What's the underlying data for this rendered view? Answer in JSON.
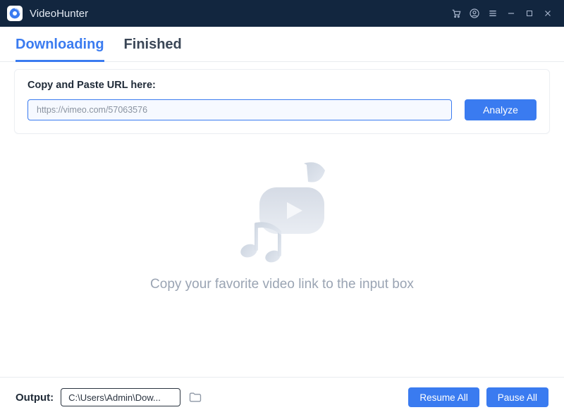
{
  "app": {
    "title": "VideoHunter"
  },
  "tabs": {
    "downloading": "Downloading",
    "finished": "Finished",
    "active": "downloading"
  },
  "input_card": {
    "label": "Copy and Paste URL here:",
    "url_value": "https://vimeo.com/57063576",
    "analyze_label": "Analyze"
  },
  "empty": {
    "hint": "Copy your favorite video link to the input box"
  },
  "footer": {
    "output_label": "Output:",
    "output_path": "C:\\Users\\Admin\\Dow...",
    "resume_all": "Resume All",
    "pause_all": "Pause All"
  },
  "colors": {
    "accent": "#3a7bf0",
    "titlebar": "#12263f"
  }
}
